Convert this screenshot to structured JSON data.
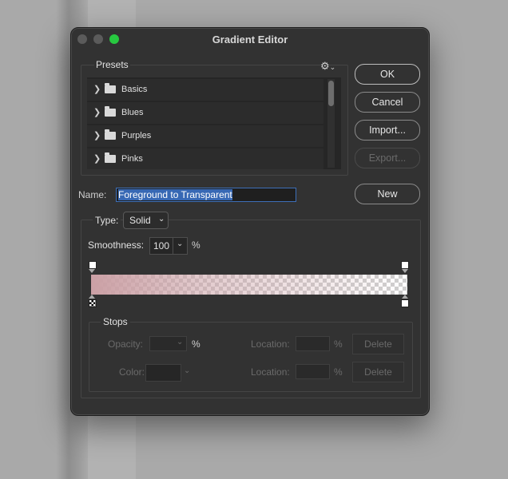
{
  "window": {
    "title": "Gradient Editor"
  },
  "presets": {
    "label": "Presets",
    "items": [
      {
        "label": "Basics"
      },
      {
        "label": "Blues"
      },
      {
        "label": "Purples"
      },
      {
        "label": "Pinks"
      }
    ]
  },
  "buttons": {
    "ok": "OK",
    "cancel": "Cancel",
    "import": "Import...",
    "export": "Export...",
    "new": "New"
  },
  "name": {
    "label": "Name:",
    "value": "Foreground to Transparent"
  },
  "type": {
    "label": "Type:",
    "value": "Solid"
  },
  "smoothness": {
    "label": "Smoothness:",
    "value": "100",
    "unit": "%"
  },
  "gradient": {
    "start_color": "#cba0a5",
    "end_opacity_percent": 0
  },
  "stops": {
    "label": "Stops",
    "opacity_label": "Opacity:",
    "opacity_unit": "%",
    "color_label": "Color:",
    "location_label": "Location:",
    "location_unit": "%",
    "delete_label": "Delete"
  },
  "icons": {
    "settings": "gear-icon",
    "expand": "chevron-right-icon",
    "folder": "folder-icon",
    "dropdown": "chevron-down-icon"
  }
}
